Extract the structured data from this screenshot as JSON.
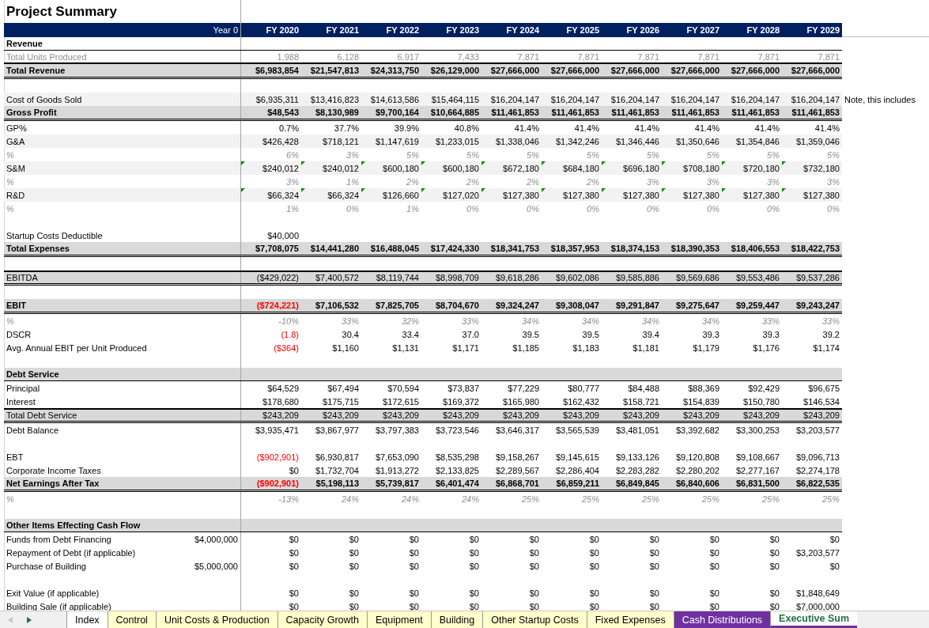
{
  "title": "Project Summary",
  "columns": [
    "Year 0",
    "FY 2020",
    "FY 2021",
    "FY 2022",
    "FY 2023",
    "FY 2024",
    "FY 2025",
    "FY 2026",
    "FY 2027",
    "FY 2028",
    "FY 2029"
  ],
  "rows": [
    {
      "kind": "heading",
      "label": "Revenue"
    },
    {
      "kind": "muted",
      "label": "Total Units Produced",
      "values": [
        "1,988",
        "6,128",
        "6,917",
        "7,433",
        "7,871",
        "7,871",
        "7,871",
        "7,871",
        "7,871",
        "7,871"
      ]
    },
    {
      "kind": "total",
      "label": "Total Revenue",
      "values": [
        "$6,983,854",
        "$21,547,813",
        "$24,313,750",
        "$26,129,000",
        "$27,666,000",
        "$27,666,000",
        "$27,666,000",
        "$27,666,000",
        "$27,666,000",
        "$27,666,000"
      ]
    },
    {
      "kind": "blank"
    },
    {
      "kind": "shaded",
      "label": "Cost of Goods Sold",
      "values": [
        "$6,935,311",
        "$13,416,823",
        "$14,613,586",
        "$15,464,115",
        "$16,204,147",
        "$16,204,147",
        "$16,204,147",
        "$16,204,147",
        "$16,204,147",
        "$16,204,147"
      ],
      "note": "Note, this includes"
    },
    {
      "kind": "total",
      "label": "Gross Profit",
      "values": [
        "$48,543",
        "$8,130,989",
        "$9,700,164",
        "$10,664,885",
        "$11,461,853",
        "$11,461,853",
        "$11,461,853",
        "$11,461,853",
        "$11,461,853",
        "$11,461,853"
      ]
    },
    {
      "kind": "plain",
      "label": "GP%",
      "values": [
        "0.7%",
        "37.7%",
        "39.9%",
        "40.8%",
        "41.4%",
        "41.4%",
        "41.4%",
        "41.4%",
        "41.4%",
        "41.4%"
      ]
    },
    {
      "kind": "shaded",
      "label": "G&A",
      "values": [
        "$426,428",
        "$718,121",
        "$1,147,619",
        "$1,233,015",
        "$1,338,046",
        "$1,342,246",
        "$1,346,446",
        "$1,350,646",
        "$1,354,846",
        "$1,359,046"
      ]
    },
    {
      "kind": "pct",
      "label": "%",
      "values": [
        "6%",
        "3%",
        "5%",
        "5%",
        "5%",
        "5%",
        "5%",
        "5%",
        "5%",
        "5%"
      ]
    },
    {
      "kind": "shaded",
      "label": "S&M",
      "flagged": true,
      "values": [
        "$240,012",
        "$240,012",
        "$600,180",
        "$600,180",
        "$672,180",
        "$684,180",
        "$696,180",
        "$708,180",
        "$720,180",
        "$732,180"
      ]
    },
    {
      "kind": "pct",
      "label": "%",
      "values": [
        "3%",
        "1%",
        "2%",
        "2%",
        "2%",
        "2%",
        "3%",
        "3%",
        "3%",
        "3%"
      ]
    },
    {
      "kind": "shaded",
      "label": "R&D",
      "flagged": true,
      "values": [
        "$66,324",
        "$66,324",
        "$126,660",
        "$127,020",
        "$127,380",
        "$127,380",
        "$127,380",
        "$127,380",
        "$127,380",
        "$127,380"
      ]
    },
    {
      "kind": "pct",
      "label": "%",
      "values": [
        "1%",
        "0%",
        "1%",
        "0%",
        "0%",
        "0%",
        "0%",
        "0%",
        "0%",
        "0%"
      ]
    },
    {
      "kind": "blank"
    },
    {
      "kind": "plain",
      "label": "Startup Costs Deductible",
      "values": [
        "$40,000"
      ]
    },
    {
      "kind": "total",
      "label": "Total Expenses",
      "values": [
        "$7,708,075",
        "$14,441,280",
        "$16,488,045",
        "$17,424,330",
        "$18,341,753",
        "$18,357,953",
        "$18,374,153",
        "$18,390,353",
        "$18,406,553",
        "$18,422,753"
      ]
    },
    {
      "kind": "blank"
    },
    {
      "kind": "subtotal",
      "label": "EBITDA",
      "values": [
        "($429,022)",
        "$7,400,572",
        "$8,119,744",
        "$8,998,709",
        "$9,618,286",
        "$9,602,086",
        "$9,585,886",
        "$9,569,686",
        "$9,553,486",
        "$9,537,286"
      ]
    },
    {
      "kind": "blank"
    },
    {
      "kind": "total",
      "label": "EBIT",
      "red_first": true,
      "values": [
        "($724,221)",
        "$7,106,532",
        "$7,825,705",
        "$8,704,670",
        "$9,324,247",
        "$9,308,047",
        "$9,291,847",
        "$9,275,647",
        "$9,259,447",
        "$9,243,247"
      ]
    },
    {
      "kind": "pct",
      "label": "%",
      "values": [
        "-10%",
        "33%",
        "32%",
        "33%",
        "34%",
        "34%",
        "34%",
        "34%",
        "33%",
        "33%"
      ]
    },
    {
      "kind": "plain",
      "label": "DSCR",
      "red_first": true,
      "values": [
        "(1.8)",
        "30.4",
        "33.4",
        "37.0",
        "39.5",
        "39.5",
        "39.4",
        "39.3",
        "39.3",
        "39.2"
      ]
    },
    {
      "kind": "plain",
      "label": "Avg. Annual EBIT per Unit Produced",
      "red_first": true,
      "values": [
        "($364)",
        "$1,160",
        "$1,131",
        "$1,171",
        "$1,185",
        "$1,183",
        "$1,181",
        "$1,179",
        "$1,176",
        "$1,174"
      ]
    },
    {
      "kind": "blank"
    },
    {
      "kind": "band",
      "label": "Debt Service"
    },
    {
      "kind": "plain",
      "label": "Principal",
      "values": [
        "$64,529",
        "$67,494",
        "$70,594",
        "$73,837",
        "$77,229",
        "$80,777",
        "$84,488",
        "$88,369",
        "$92,429",
        "$96,675"
      ]
    },
    {
      "kind": "plain",
      "label": "Interest",
      "values": [
        "$178,680",
        "$175,715",
        "$172,615",
        "$169,372",
        "$165,980",
        "$162,432",
        "$158,721",
        "$154,839",
        "$150,780",
        "$146,534"
      ]
    },
    {
      "kind": "subtotal",
      "label": "Total Debt Service",
      "values": [
        "$243,209",
        "$243,209",
        "$243,209",
        "$243,209",
        "$243,209",
        "$243,209",
        "$243,209",
        "$243,209",
        "$243,209",
        "$243,209"
      ]
    },
    {
      "kind": "plain",
      "label": "Debt Balance",
      "values": [
        "$3,935,471",
        "$3,867,977",
        "$3,797,383",
        "$3,723,546",
        "$3,646,317",
        "$3,565,539",
        "$3,481,051",
        "$3,392,682",
        "$3,300,253",
        "$3,203,577"
      ]
    },
    {
      "kind": "blank"
    },
    {
      "kind": "plain",
      "label": "EBT",
      "red_first": true,
      "values": [
        "($902,901)",
        "$6,930,817",
        "$7,653,090",
        "$8,535,298",
        "$9,158,267",
        "$9,145,615",
        "$9,133,126",
        "$9,120,808",
        "$9,108,667",
        "$9,096,713"
      ]
    },
    {
      "kind": "plain",
      "label": "Corporate Income Taxes",
      "values": [
        "$0",
        "$1,732,704",
        "$1,913,272",
        "$2,133,825",
        "$2,289,567",
        "$2,286,404",
        "$2,283,282",
        "$2,280,202",
        "$2,277,167",
        "$2,274,178"
      ]
    },
    {
      "kind": "total",
      "label": "Net Earnings After Tax",
      "red_first": true,
      "values": [
        "($902,901)",
        "$5,198,113",
        "$5,739,817",
        "$6,401,474",
        "$6,868,701",
        "$6,859,211",
        "$6,849,845",
        "$6,840,606",
        "$6,831,500",
        "$6,822,535"
      ]
    },
    {
      "kind": "pct",
      "label": "%",
      "values": [
        "-13%",
        "24%",
        "24%",
        "24%",
        "25%",
        "25%",
        "25%",
        "25%",
        "25%",
        "25%"
      ]
    },
    {
      "kind": "blank"
    },
    {
      "kind": "band",
      "label": "Other Items Effecting Cash Flow"
    },
    {
      "kind": "plain",
      "label": "Funds from Debt Financing",
      "year0": "$4,000,000",
      "values": [
        "$0",
        "$0",
        "$0",
        "$0",
        "$0",
        "$0",
        "$0",
        "$0",
        "$0",
        "$0"
      ]
    },
    {
      "kind": "plain",
      "label": "Repayment of Debt (if applicable)",
      "values": [
        "$0",
        "$0",
        "$0",
        "$0",
        "$0",
        "$0",
        "$0",
        "$0",
        "$0",
        "$3,203,577"
      ]
    },
    {
      "kind": "plain",
      "label": "Purchase of Building",
      "year0": "$5,000,000",
      "values": [
        "$0",
        "$0",
        "$0",
        "$0",
        "$0",
        "$0",
        "$0",
        "$0",
        "$0",
        "$0"
      ]
    },
    {
      "kind": "blank"
    },
    {
      "kind": "plain",
      "label": "Exit Value (if applicable)",
      "values": [
        "$0",
        "$0",
        "$0",
        "$0",
        "$0",
        "$0",
        "$0",
        "$0",
        "$0",
        "$1,848,649"
      ]
    },
    {
      "kind": "plain",
      "label": "Building Sale (if applicable)",
      "values": [
        "$0",
        "$0",
        "$0",
        "$0",
        "$0",
        "$0",
        "$0",
        "$0",
        "$0",
        "$7,000,000"
      ]
    }
  ],
  "tabs": [
    {
      "label": "Index",
      "color": "#ffffff",
      "selected": false
    },
    {
      "label": "Control",
      "color": "#ffffcc",
      "selected": false
    },
    {
      "label": "Unit Costs & Production",
      "color": "#ffffcc",
      "selected": false
    },
    {
      "label": "Capacity Growth",
      "color": "#ffffcc",
      "selected": false
    },
    {
      "label": "Equipment",
      "color": "#ffffcc",
      "selected": false
    },
    {
      "label": "Building",
      "color": "#ffffcc",
      "selected": false
    },
    {
      "label": "Other Startup Costs",
      "color": "#ffffcc",
      "selected": false
    },
    {
      "label": "Fixed Expenses",
      "color": "#ffffcc",
      "selected": false
    },
    {
      "label": "Cash Distributions",
      "color": "#7030a0",
      "selected": false
    },
    {
      "label": "Executive Sum",
      "color": "#7030a0",
      "selected": true
    }
  ]
}
